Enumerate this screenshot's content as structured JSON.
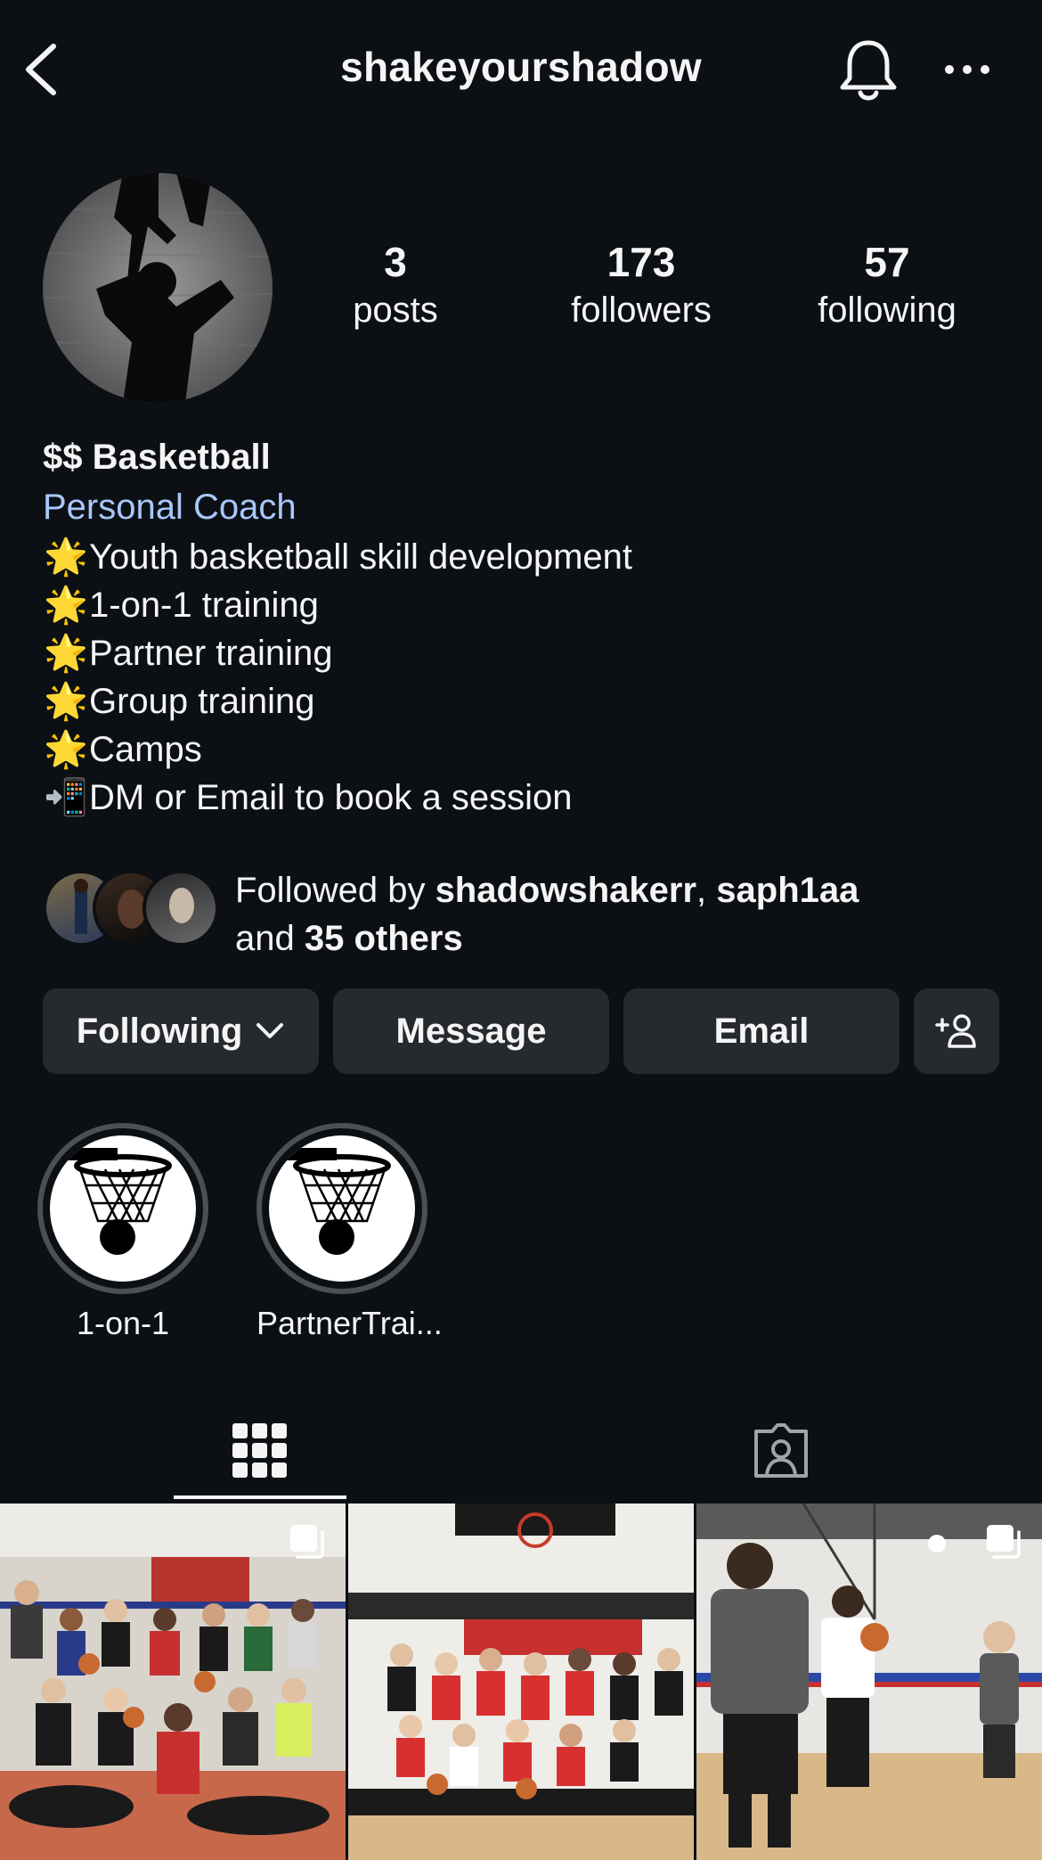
{
  "header": {
    "username": "shakeyourshadow"
  },
  "stats": {
    "posts": {
      "value": "3",
      "label": "posts"
    },
    "followers": {
      "value": "173",
      "label": "followers"
    },
    "following": {
      "value": "57",
      "label": "following"
    }
  },
  "bio": {
    "name": "$$ Basketball",
    "category": "Personal Coach",
    "lines": [
      {
        "emoji": "🌟",
        "text": "Youth basketball skill development"
      },
      {
        "emoji": "🌟",
        "text": "1-on-1 training"
      },
      {
        "emoji": "🌟",
        "text": "Partner training"
      },
      {
        "emoji": "🌟",
        "text": "Group training"
      },
      {
        "emoji": "🌟",
        "text": "Camps"
      },
      {
        "emoji": "📲",
        "text": "DM or Email to book a session"
      }
    ]
  },
  "followed_by": {
    "prefix": "Followed by ",
    "user1": "shadowshakerr",
    "separator": ", ",
    "user2": "saph1aa",
    "and": "and ",
    "others": "35 others"
  },
  "actions": {
    "following_label": "Following",
    "message_label": "Message",
    "email_label": "Email"
  },
  "highlights": [
    {
      "label": "1-on-1"
    },
    {
      "label": "PartnerTrai..."
    }
  ],
  "tabs": {
    "active": "posts-grid"
  },
  "icons": {
    "back": "chevron-left-icon",
    "notifications": "bell-icon",
    "more": "ellipsis-icon",
    "dropdown": "chevron-down-icon",
    "suggest": "add-person-icon",
    "grid": "grid-icon",
    "tagged": "tagged-person-icon",
    "multi_post": "carousel-icon"
  },
  "colors": {
    "background": "#0c1014",
    "button": "#262a2f",
    "link": "#a8c7fa",
    "text": "#f5f5f5"
  }
}
